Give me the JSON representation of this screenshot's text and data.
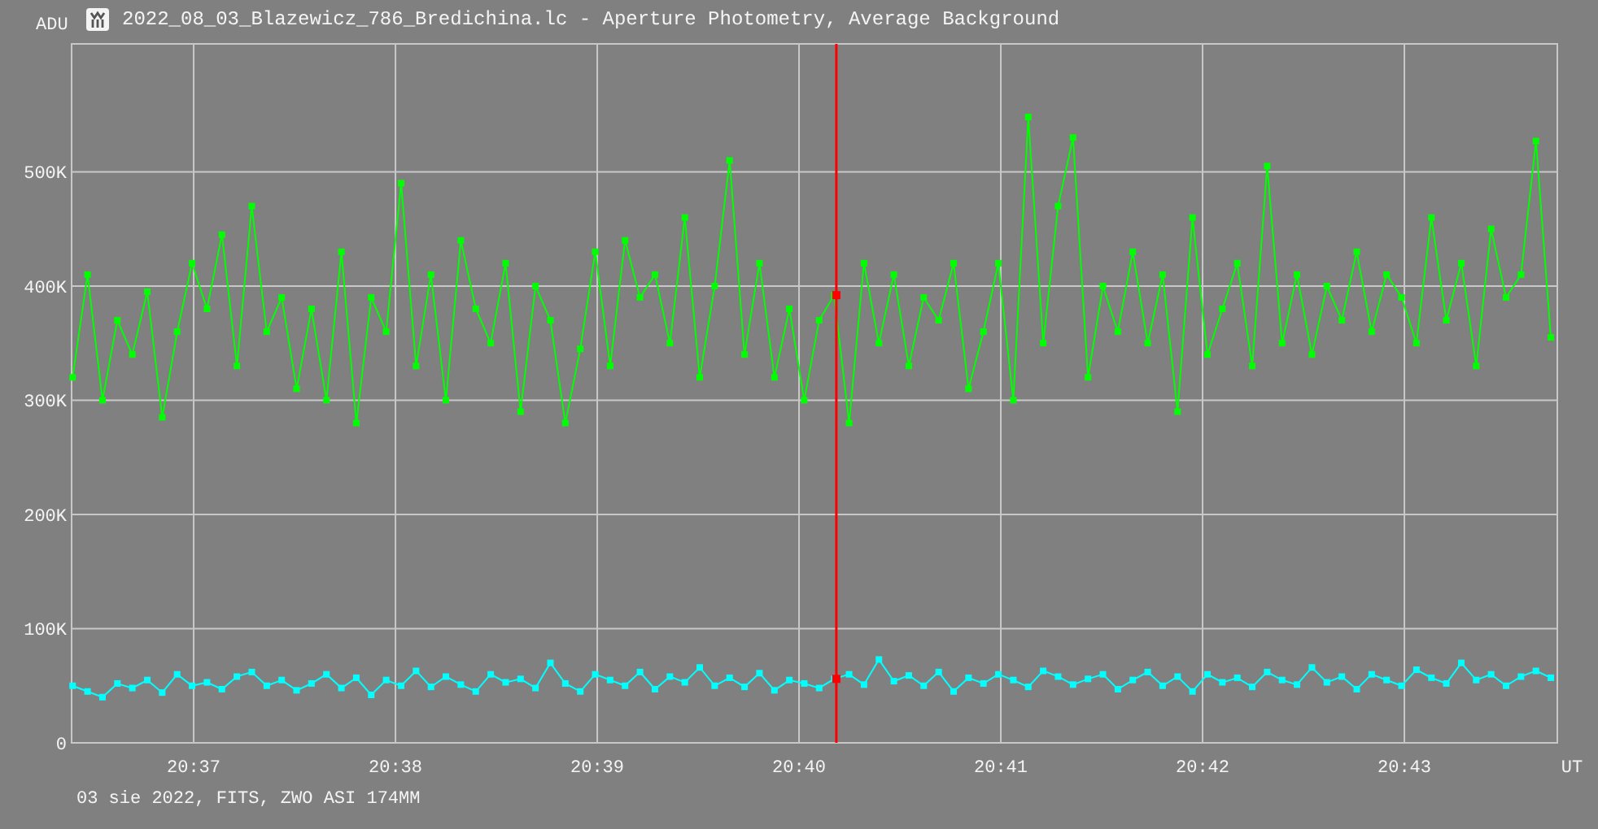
{
  "chart": {
    "chart_data": {
      "type": "line",
      "title": "2022_08_03_Blazewicz_786_Bredichina.lc - Aperture Photometry, Average Background",
      "xlabel": "UT",
      "ylabel": "ADU",
      "x": [
        1236.4,
        1236.474,
        1236.548,
        1236.622,
        1236.696,
        1236.77,
        1236.844,
        1236.918,
        1236.992,
        1237.066,
        1237.14,
        1237.214,
        1237.288,
        1237.362,
        1237.436,
        1237.51,
        1237.584,
        1237.658,
        1237.732,
        1237.806,
        1237.88,
        1237.954,
        1238.028,
        1238.102,
        1238.176,
        1238.25,
        1238.324,
        1238.398,
        1238.472,
        1238.546,
        1238.62,
        1238.694,
        1238.768,
        1238.842,
        1238.916,
        1238.99,
        1239.064,
        1239.138,
        1239.212,
        1239.286,
        1239.36,
        1239.434,
        1239.508,
        1239.582,
        1239.656,
        1239.73,
        1239.804,
        1239.878,
        1239.952,
        1240.026,
        1240.1,
        1240.174,
        1240.248,
        1240.322,
        1240.396,
        1240.47,
        1240.544,
        1240.618,
        1240.692,
        1240.766,
        1240.84,
        1240.914,
        1240.988,
        1241.062,
        1241.136,
        1241.21,
        1241.284,
        1241.358,
        1241.432,
        1241.506,
        1241.58,
        1241.654,
        1241.728,
        1241.802,
        1241.876,
        1241.95,
        1242.024,
        1242.098,
        1242.172,
        1242.246,
        1242.32,
        1242.394,
        1242.468,
        1242.542,
        1242.616,
        1242.69,
        1242.764,
        1242.838,
        1242.912,
        1242.986,
        1243.06,
        1243.134,
        1243.208,
        1243.282,
        1243.356,
        1243.43,
        1243.504,
        1243.578,
        1243.652,
        1243.726
      ],
      "series": [
        {
          "color": "#00ff00",
          "marker": "square",
          "values": [
            320,
            410,
            300,
            370,
            340,
            395,
            285,
            360,
            420,
            380,
            445,
            330,
            470,
            360,
            390,
            310,
            380,
            300,
            430,
            280,
            390,
            360,
            490,
            330,
            410,
            300,
            440,
            380,
            350,
            420,
            290,
            400,
            370,
            280,
            345,
            430,
            330,
            440,
            390,
            410,
            350,
            460,
            320,
            400,
            510,
            340,
            420,
            320,
            380,
            300,
            370,
            392,
            280,
            420,
            350,
            410,
            330,
            390,
            370,
            420,
            310,
            360,
            420,
            300,
            548,
            350,
            470,
            530,
            320,
            400,
            360,
            430,
            350,
            410,
            290,
            460,
            340,
            380,
            420,
            330,
            505,
            350,
            410,
            340,
            400,
            370,
            430,
            360,
            410,
            390,
            350,
            460,
            370,
            420,
            330,
            450,
            390,
            410,
            527,
            355
          ]
        },
        {
          "color": "#00ffff",
          "marker": "square",
          "values": [
            50,
            45,
            40,
            52,
            48,
            55,
            44,
            60,
            50,
            53,
            47,
            58,
            62,
            50,
            55,
            46,
            52,
            60,
            48,
            57,
            42,
            55,
            50,
            63,
            49,
            58,
            51,
            45,
            60,
            53,
            56,
            48,
            70,
            52,
            45,
            60,
            55,
            50,
            62,
            47,
            58,
            53,
            66,
            50,
            57,
            49,
            61,
            46,
            55,
            52,
            48,
            56,
            60,
            51,
            73,
            54,
            59,
            50,
            62,
            45,
            57,
            52,
            60,
            55,
            49,
            63,
            58,
            51,
            56,
            60,
            47,
            55,
            62,
            50,
            58,
            45,
            60,
            53,
            57,
            49,
            62,
            55,
            51,
            66,
            53,
            58,
            47,
            60,
            55,
            50,
            64,
            57,
            52,
            70,
            55,
            60,
            50,
            58,
            63,
            57
          ]
        }
      ],
      "grid": true,
      "xlim": [
        1236.395,
        1243.758
      ],
      "ylim": [
        0,
        612
      ],
      "xticks": [
        {
          "value": 1237,
          "label": "20:37"
        },
        {
          "value": 1238,
          "label": "20:38"
        },
        {
          "value": 1239,
          "label": "20:39"
        },
        {
          "value": 1240,
          "label": "20:40"
        },
        {
          "value": 1241,
          "label": "20:41"
        },
        {
          "value": 1242,
          "label": "20:42"
        },
        {
          "value": 1243,
          "label": "20:43"
        }
      ],
      "yticks": [
        {
          "value": 0,
          "label": "0"
        },
        {
          "value": 100,
          "label": "100K"
        },
        {
          "value": 200,
          "label": "200K"
        },
        {
          "value": 300,
          "label": "300K"
        },
        {
          "value": 400,
          "label": "400K"
        },
        {
          "value": 500,
          "label": "500K"
        }
      ],
      "ref_lines": [
        {
          "axis": "x",
          "value": 1240.185
        }
      ]
    }
  },
  "footer": "03 sie 2022, FITS, ZWO ASI 174MM"
}
